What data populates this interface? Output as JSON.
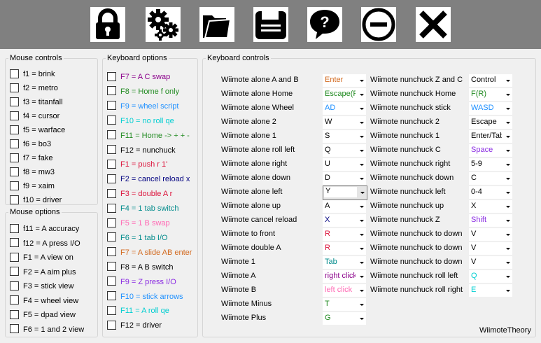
{
  "toolbar": {
    "buttons": [
      {
        "icon": "lock-icon"
      },
      {
        "icon": "gears-icon"
      },
      {
        "icon": "folder-icon"
      },
      {
        "icon": "save-icon"
      },
      {
        "icon": "help-icon"
      },
      {
        "icon": "minimize-icon"
      },
      {
        "icon": "close-icon"
      }
    ]
  },
  "mouse_controls": {
    "title": "Mouse controls",
    "items": [
      "f1 = brink",
      "f2 = metro",
      "f3 = titanfall",
      "f4 = cursor",
      "f5 = warface",
      "f6 = bo3",
      "f7 = fake",
      "f8 = mw3",
      "f9 = xaim",
      "f10 = driver"
    ]
  },
  "mouse_options": {
    "title": "Mouse options",
    "items": [
      "f11 = A accuracy",
      "f12 = A press I/O",
      "F1 = A view on",
      "F2 = A aim plus",
      "F3 = stick view",
      "F4 = wheel view",
      "F5 = dpad view",
      "F6 = 1 and 2 view"
    ]
  },
  "keyboard_options": {
    "title": "Keyboard options",
    "items": [
      {
        "label": "F7 = A C swap",
        "color": "#8b008b"
      },
      {
        "label": "F8 = Home f only",
        "color": "#228b22"
      },
      {
        "label": "F9 = wheel script",
        "color": "#1e90ff"
      },
      {
        "label": "F10 = no roll qe",
        "color": "#00ced1"
      },
      {
        "label": "F11 = Home -> + + -",
        "color": "#228b22"
      },
      {
        "label": "F12 = nunchuck",
        "color": "#000000"
      },
      {
        "label": "F1 = push r 1'",
        "color": "#dc143c"
      },
      {
        "label": "F2 = cancel reload x",
        "color": "#000080"
      },
      {
        "label": "F3 = double A r",
        "color": "#dc143c"
      },
      {
        "label": "F4 = 1 tab switch",
        "color": "#008b8b"
      },
      {
        "label": "F5 = 1 B swap",
        "color": "#ff69b4"
      },
      {
        "label": "F6 = 1 tab I/O",
        "color": "#008b8b"
      },
      {
        "label": "F7 = A slide AB enter",
        "color": "#d2691e"
      },
      {
        "label": "F8 = A B switch",
        "color": "#000000"
      },
      {
        "label": "F9 = Z press I/O",
        "color": "#8a2be2"
      },
      {
        "label": "F10 = stick arrows",
        "color": "#1e90ff"
      },
      {
        "label": "F11 = A roll qe",
        "color": "#00ced1"
      },
      {
        "label": "F12 = driver",
        "color": "#000000"
      }
    ]
  },
  "keyboard_controls": {
    "title": "Keyboard controls",
    "left": [
      {
        "label": "Wiimote alone A and B",
        "value": "Enter",
        "color": "#d2691e"
      },
      {
        "label": "Wiimote alone Home",
        "value": "Escape(R)",
        "color": "#228b22"
      },
      {
        "label": "Wiimote alone Wheel",
        "value": "AD",
        "color": "#1e90ff"
      },
      {
        "label": "Wiimote alone 2",
        "value": "W",
        "color": "#000000"
      },
      {
        "label": "Wiimote alone 1",
        "value": "S",
        "color": "#000000"
      },
      {
        "label": "Wiimote alone roll left",
        "value": "Q",
        "color": "#000000"
      },
      {
        "label": "Wiimote alone right",
        "value": "U",
        "color": "#000000"
      },
      {
        "label": "Wiimote alone down",
        "value": "D",
        "color": "#000000"
      },
      {
        "label": "Wiimote alone left",
        "value": "Y",
        "color": "#000000",
        "focused": true
      },
      {
        "label": "Wiimote alone up",
        "value": "A",
        "color": "#000000"
      },
      {
        "label": "Wiimote cancel reload",
        "value": "X",
        "color": "#000080"
      },
      {
        "label": "Wiimote to front",
        "value": "R",
        "color": "#dc143c"
      },
      {
        "label": "Wiimote double A",
        "value": "R",
        "color": "#dc143c"
      },
      {
        "label": "Wiimote 1",
        "value": "Tab",
        "color": "#008b8b"
      },
      {
        "label": "Wiimote A",
        "value": "right click",
        "color": "#8b008b"
      },
      {
        "label": "Wiimote B",
        "value": "left click",
        "color": "#ff69b4"
      },
      {
        "label": "Wiimote Minus",
        "value": "T",
        "color": "#228b22"
      },
      {
        "label": "Wiimote Plus",
        "value": "G",
        "color": "#228b22"
      }
    ],
    "right": [
      {
        "label": "Wiimote nunchuck Z and C",
        "value": "Control",
        "color": "#000000"
      },
      {
        "label": "Wiimote nunchuck Home",
        "value": "F(R)",
        "color": "#228b22"
      },
      {
        "label": "Wiimote nunchuck stick",
        "value": "WASD",
        "color": "#1e90ff"
      },
      {
        "label": "Wiimote nunchuck 2",
        "value": "Escape",
        "color": "#000000"
      },
      {
        "label": "Wiimote nunchuck 1",
        "value": "Enter/Tab",
        "color": "#000000"
      },
      {
        "label": "Wiimote nunchuck C",
        "value": "Space",
        "color": "#8a2be2"
      },
      {
        "label": "Wiimote nunchuck right",
        "value": "5-9",
        "color": "#000000"
      },
      {
        "label": "Wiimote nunchuck down",
        "value": "C",
        "color": "#000000"
      },
      {
        "label": "Wiimote nunchuck left",
        "value": "0-4",
        "color": "#000000"
      },
      {
        "label": "Wiimote nunchuck up",
        "value": "X",
        "color": "#000000"
      },
      {
        "label": "Wiimote nunchuck Z",
        "value": "Shift",
        "color": "#8a2be2"
      },
      {
        "label": "Wiimote nunchuck to down",
        "value": "V",
        "color": "#000000"
      },
      {
        "label": "Wiimote nunchuck to down",
        "value": "V",
        "color": "#000000"
      },
      {
        "label": "Wiimote nunchuck to down",
        "value": "V",
        "color": "#000000"
      },
      {
        "label": "Wiimote nunchuck roll left",
        "value": "Q",
        "color": "#00ced1"
      },
      {
        "label": "Wiimote nunchuck roll right",
        "value": "E",
        "color": "#00ced1"
      }
    ]
  },
  "credit": "WiimoteTheory"
}
